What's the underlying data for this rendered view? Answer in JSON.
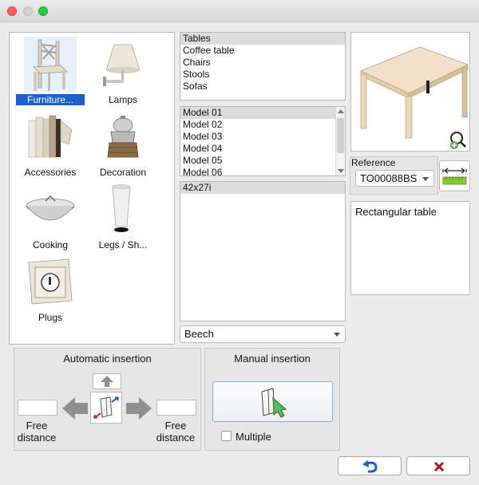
{
  "categories": [
    {
      "label": "Furniture...",
      "icon": "chair-icon",
      "selected": true
    },
    {
      "label": "Lamps",
      "icon": "lamp-icon"
    },
    {
      "label": "Accessories",
      "icon": "books-icon"
    },
    {
      "label": "Decoration",
      "icon": "teapot-icon"
    },
    {
      "label": "Cooking",
      "icon": "wok-icon"
    },
    {
      "label": "Legs / Sh...",
      "icon": "leg-icon"
    },
    {
      "label": "Plugs",
      "icon": "plug-icon"
    }
  ],
  "families": [
    "Tables",
    "Coffee table",
    "Chairs",
    "Stools",
    "Sofas"
  ],
  "models": [
    "Model 01",
    "Model 02",
    "Model 03",
    "Model 04",
    "Model 05",
    "Model 06"
  ],
  "sizes": [
    "42x27i"
  ],
  "material": {
    "value": "Beech"
  },
  "reference": {
    "label": "Reference",
    "value": "TO00088BS"
  },
  "description": "Rectangular table",
  "auto_insertion": {
    "title": "Automatic insertion",
    "left_label": "Free distance",
    "right_label": "Free distance",
    "left_value": "",
    "right_value": ""
  },
  "manual_insertion": {
    "title": "Manual insertion",
    "multiple_label": "Multiple"
  },
  "colors": {
    "selection": "#1a5fd1",
    "undo": "#1a5fd1",
    "cancel": "#b5121b"
  }
}
